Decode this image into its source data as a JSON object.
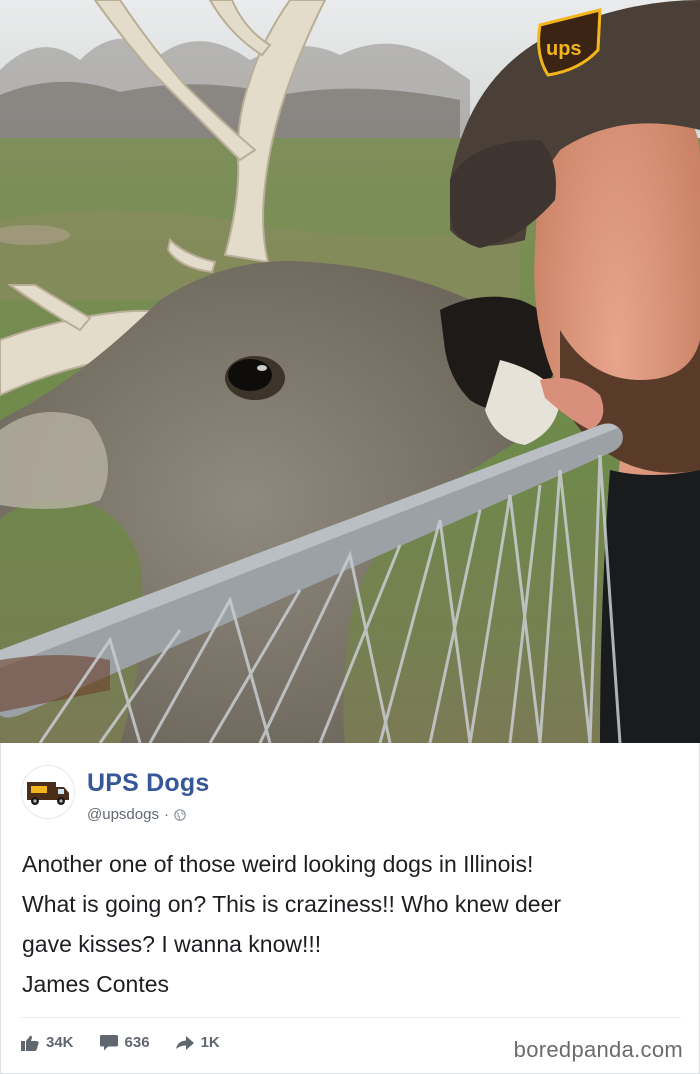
{
  "post": {
    "page_name": "UPS Dogs",
    "handle": "@upsdogs",
    "separator": "·",
    "text_lines": [
      "Another one of those weird looking dogs in Illinois!",
      "What is going on? This is craziness!! Who knew deer",
      "gave kisses? I wanna know!!!",
      "James Contes"
    ],
    "photo_cap_logo": "ups"
  },
  "stats": {
    "likes": "34K",
    "comments": "636",
    "shares": "1K"
  },
  "icons": {
    "avatar": "ups-truck-icon",
    "privacy": "globe-icon",
    "like": "thumbs-up-icon",
    "comment": "comment-icon",
    "share": "share-arrow-icon"
  },
  "watermark": "boredpanda.com",
  "colors": {
    "page_name": "#365899",
    "body_text": "#1c1e21",
    "muted": "#616770",
    "ups_brown": "#4b2e1a",
    "ups_gold": "#f2b51c"
  }
}
